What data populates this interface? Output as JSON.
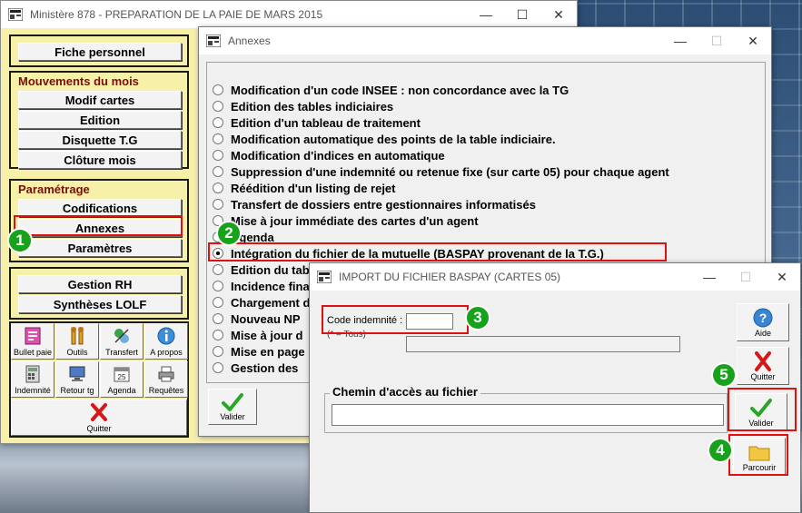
{
  "main_window": {
    "title": "Ministère 878 - PREPARATION DE LA PAIE DE MARS 2015",
    "fiche_personnel": "Fiche personnel",
    "mouvements": {
      "title": "Mouvements du mois",
      "buttons": [
        "Modif cartes",
        "Edition",
        "Disquette T.G",
        "Clôture mois"
      ]
    },
    "parametrage": {
      "title": "Paramétrage",
      "buttons": [
        "Codifications",
        "Annexes",
        "Paramètres"
      ]
    },
    "rh": {
      "buttons": [
        "Gestion RH",
        "Synthèses LOLF"
      ]
    },
    "icons": [
      "Bullet paie",
      "Outils",
      "Transfert",
      "A propos",
      "Indemnité",
      "Retour tg",
      "Agenda",
      "Requêtes"
    ],
    "quitter": "Quitter"
  },
  "annexes_window": {
    "title": "Annexes",
    "options": [
      "Modification d'un code INSEE : non concordance avec la TG",
      "Edition des tables indiciaires",
      "Edition d'un tableau de traitement",
      "Modification automatique des points de la table indiciaire.",
      "Modification d'indices en automatique",
      "Suppression d'une indemnité ou retenue fixe (sur carte 05) pour chaque agent",
      "Réédition d'un listing de rejet",
      "Transfert de dossiers entre gestionnaires informatisés",
      "Mise à jour immédiate des cartes d'un agent",
      "Agenda",
      "Intégration du fichier de la mutuelle (BASPAY provenant de la T.G.)",
      "Edition du tab",
      "Incidence fina",
      "Chargement d",
      "Nouveau NP",
      "Mise à jour d",
      "Mise en page",
      "Gestion des"
    ],
    "selected_index": 10,
    "valider": "Valider"
  },
  "import_window": {
    "title": "IMPORT DU FICHIER BASPAY (CARTES 05)",
    "code_label": "Code indemnité :",
    "code_hint": "(* = Tous)",
    "code_value": "",
    "chemin_label": "Chemin d'accès au fichier",
    "chemin_value": "",
    "aide": "Aide",
    "quitter": "Quitter",
    "valider": "Valider",
    "parcourir": "Parcourir"
  },
  "steps": [
    "1",
    "2",
    "3",
    "4",
    "5"
  ],
  "colors": {
    "highlight": "#e01010",
    "step_badge": "#18a21c",
    "group_title": "#7a0c0c",
    "panel": "#f6f0a8"
  }
}
